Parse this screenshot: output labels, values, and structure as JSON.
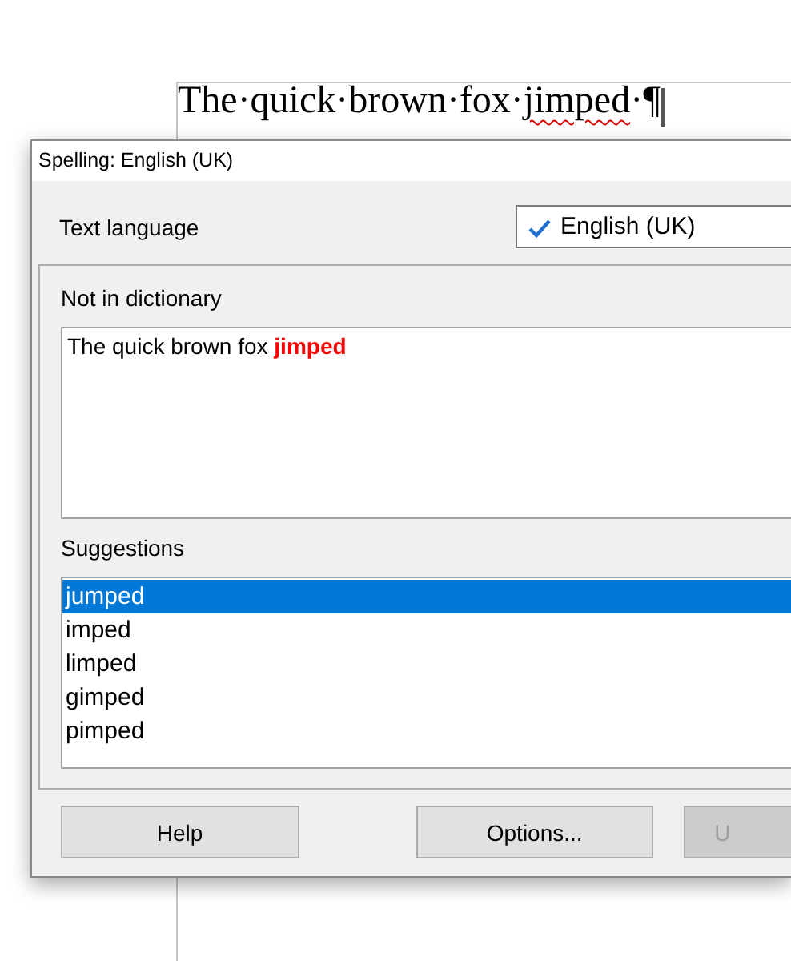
{
  "document": {
    "words": [
      {
        "text": "The·quick·brown·fox·",
        "misspelled": false
      },
      {
        "text": "jimped",
        "misspelled": true
      },
      {
        "text": "·¶",
        "misspelled": false
      }
    ]
  },
  "dialog": {
    "title": "Spelling: English (UK)",
    "text_language": {
      "label": "Text language",
      "value": "English (UK)"
    },
    "not_in_dictionary": {
      "label": "Not in dictionary",
      "text": "The quick brown fox **jimped**"
    },
    "suggestions": {
      "label": "Suggestions",
      "items": [
        {
          "text": "jumped",
          "selected": true
        },
        {
          "text": "imped",
          "selected": false
        },
        {
          "text": "limped",
          "selected": false
        },
        {
          "text": "gimped",
          "selected": false
        },
        {
          "text": "pimped",
          "selected": false
        }
      ]
    },
    "buttons": [
      {
        "label": "Help",
        "disabled": false
      },
      {
        "label": "Options...",
        "disabled": false
      },
      {
        "label": "U",
        "disabled": true
      }
    ]
  }
}
